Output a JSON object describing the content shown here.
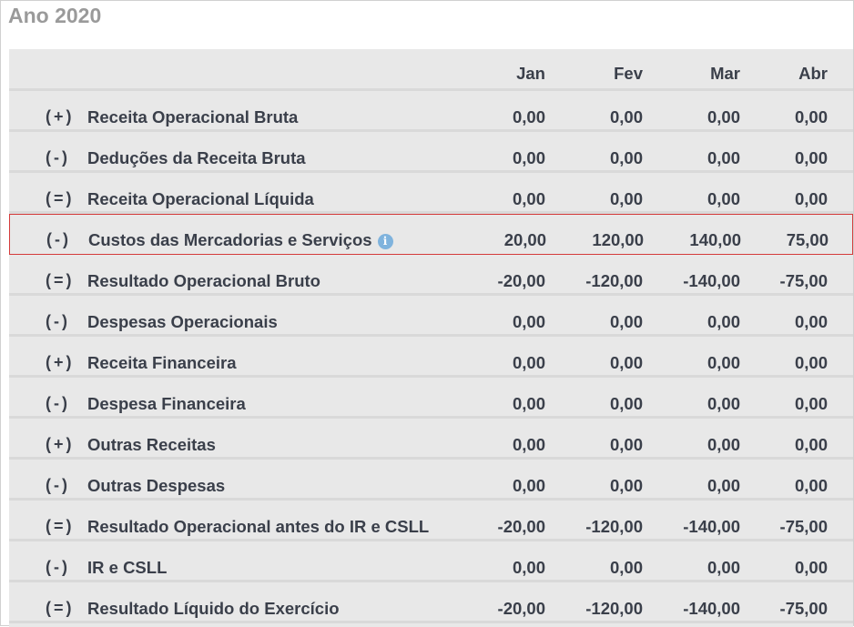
{
  "page": {
    "title": "Ano 2020"
  },
  "table": {
    "columns": [
      "Jan",
      "Fev",
      "Mar",
      "Abr"
    ],
    "rows": [
      {
        "sign": "(+)",
        "label": "Receita Operacional Bruta",
        "values": [
          "0,00",
          "0,00",
          "0,00",
          "0,00"
        ]
      },
      {
        "sign": "(-)",
        "label": "Deduções da Receita Bruta",
        "values": [
          "0,00",
          "0,00",
          "0,00",
          "0,00"
        ]
      },
      {
        "sign": "(=)",
        "label": "Receita Operacional Líquida",
        "values": [
          "0,00",
          "0,00",
          "0,00",
          "0,00"
        ]
      },
      {
        "sign": "(-)",
        "label": "Custos das Mercadorias e Serviços",
        "values": [
          "20,00",
          "120,00",
          "140,00",
          "75,00"
        ],
        "info_icon": "info-icon",
        "highlighted": true
      },
      {
        "sign": "(=)",
        "label": "Resultado Operacional Bruto",
        "values": [
          "-20,00",
          "-120,00",
          "-140,00",
          "-75,00"
        ]
      },
      {
        "sign": "(-)",
        "label": "Despesas Operacionais",
        "values": [
          "0,00",
          "0,00",
          "0,00",
          "0,00"
        ]
      },
      {
        "sign": "(+)",
        "label": "Receita Financeira",
        "values": [
          "0,00",
          "0,00",
          "0,00",
          "0,00"
        ]
      },
      {
        "sign": "(-)",
        "label": "Despesa Financeira",
        "values": [
          "0,00",
          "0,00",
          "0,00",
          "0,00"
        ]
      },
      {
        "sign": "(+)",
        "label": "Outras Receitas",
        "values": [
          "0,00",
          "0,00",
          "0,00",
          "0,00"
        ]
      },
      {
        "sign": "(-)",
        "label": "Outras Despesas",
        "values": [
          "0,00",
          "0,00",
          "0,00",
          "0,00"
        ]
      },
      {
        "sign": "(=)",
        "label": "Resultado Operacional antes do IR e CSLL",
        "values": [
          "-20,00",
          "-120,00",
          "-140,00",
          "-75,00"
        ]
      },
      {
        "sign": "(-)",
        "label": "IR e CSLL",
        "values": [
          "0,00",
          "0,00",
          "0,00",
          "0,00"
        ]
      },
      {
        "sign": "(=)",
        "label": "Resultado Líquido do Exercício",
        "values": [
          "-20,00",
          "-120,00",
          "-140,00",
          "-75,00"
        ]
      }
    ]
  },
  "colors": {
    "highlight_border": "#d43a3a",
    "info_icon": "#7fb3dd",
    "title": "#9a9a9a"
  }
}
